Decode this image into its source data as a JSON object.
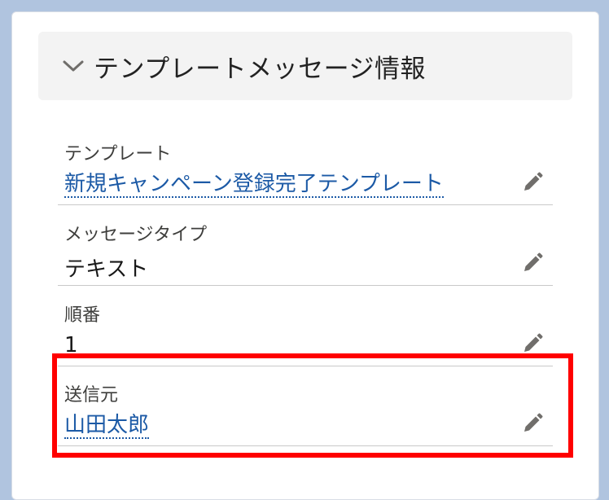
{
  "section": {
    "title": "テンプレートメッセージ情報",
    "chevron_icon": "chevron-down-icon"
  },
  "fields": [
    {
      "label": "テンプレート",
      "value": "新規キャンペーン登録完了テンプレート",
      "is_link": true,
      "edit_icon": "pencil-icon"
    },
    {
      "label": "メッセージタイプ",
      "value": "テキスト",
      "is_link": false,
      "edit_icon": "pencil-icon"
    },
    {
      "label": "順番",
      "value": "1",
      "is_link": false,
      "edit_icon": "pencil-icon"
    },
    {
      "label": "送信元",
      "value": "山田太郎",
      "is_link": true,
      "edit_icon": "pencil-icon"
    }
  ],
  "colors": {
    "background": "#b0c4df",
    "link": "#1c5aa6",
    "highlight": "#ff0000",
    "icon": "#706e6b"
  }
}
